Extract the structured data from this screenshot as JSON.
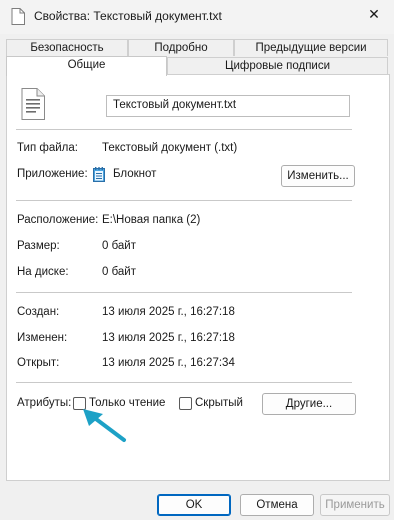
{
  "window": {
    "title": "Свойства: Текстовый документ.txt",
    "close_glyph": "✕"
  },
  "tabs": {
    "row1": [
      "Безопасность",
      "Подробно",
      "Предыдущие версии"
    ],
    "row2": [
      "Общие",
      "Цифровые подписи"
    ],
    "active": "Общие"
  },
  "general": {
    "file_name": "Текстовый документ.txt",
    "file_type_label": "Тип файла:",
    "file_type_value": "Текстовый документ (.txt)",
    "app_label": "Приложение:",
    "app_value": "Блокнот",
    "change_button": "Изменить...",
    "location_label": "Расположение:",
    "location_value": "E:\\Новая папка (2)",
    "size_label": "Размер:",
    "size_value": "0 байт",
    "disk_label": "На диске:",
    "disk_value": "0 байт",
    "created_label": "Создан:",
    "created_value": "13 июля 2025 г., 16:27:18",
    "modified_label": "Изменен:",
    "modified_value": "13 июля 2025 г., 16:27:18",
    "opened_label": "Открыт:",
    "opened_value": "13 июля 2025 г., 16:27:34",
    "attributes_label": "Атрибуты:",
    "readonly_label": "Только чтение",
    "readonly_checked": false,
    "hidden_label": "Скрытый",
    "hidden_checked": false,
    "other_button": "Другие..."
  },
  "footer": {
    "ok": "OK",
    "cancel": "Отмена",
    "apply": "Применить"
  },
  "colors": {
    "accent": "#0067c0",
    "annotation_arrow": "#1da1c6"
  },
  "icons": {
    "title": "document-icon",
    "file": "text-document-icon",
    "app": "notepad-icon",
    "annotation": "pointer-arrow-icon"
  }
}
